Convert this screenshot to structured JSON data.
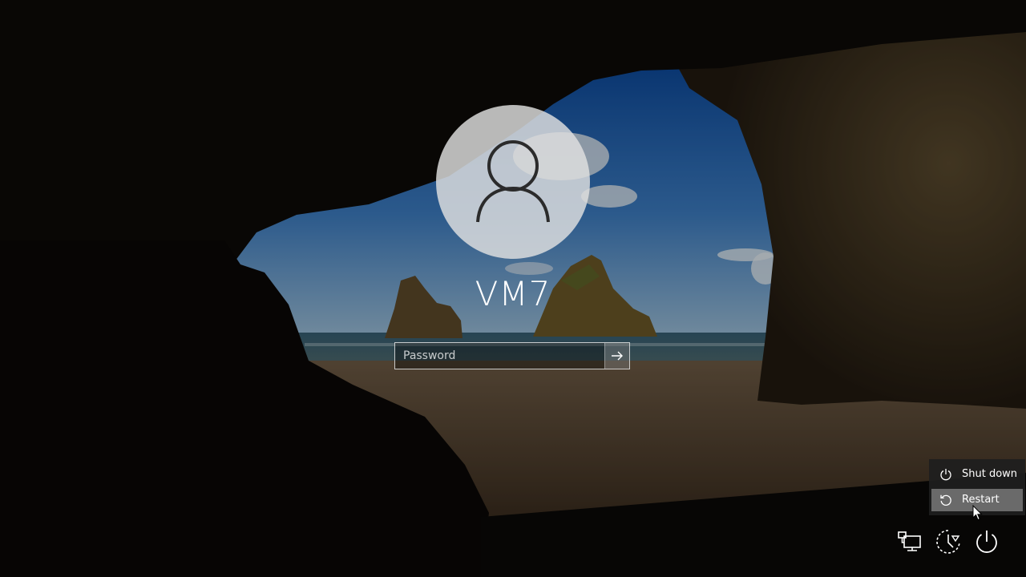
{
  "login": {
    "username": "VM7",
    "password_placeholder": "Password"
  },
  "power_menu": {
    "items": [
      {
        "label": "Shut down",
        "icon": "power-icon"
      },
      {
        "label": "Restart",
        "icon": "restart-icon",
        "highlighted": true
      }
    ]
  },
  "tray": {
    "icons": [
      "network-icon",
      "ease-of-access-icon",
      "power-icon"
    ]
  },
  "colors": {
    "avatar_bg": "#e1e1e1",
    "menu_bg": "#1e1e1e",
    "menu_highlight": "#8c8c8c"
  }
}
